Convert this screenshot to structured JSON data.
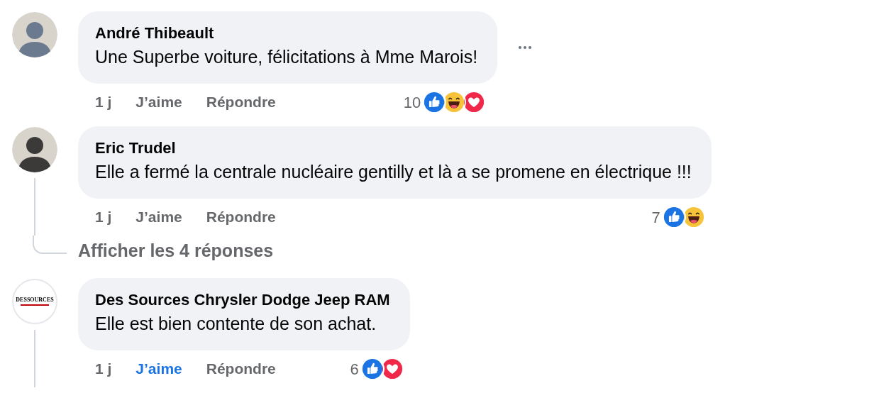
{
  "comments": [
    {
      "author": "André Thibeault",
      "text": "Une Superbe voiture, félicitations à Mme Marois!",
      "avatar": {
        "kind": "photo",
        "color": "#6b7a8f"
      },
      "more_button": true,
      "time": "1 j",
      "like_label": "J’aime",
      "liked": false,
      "reply_label": "Répondre",
      "reaction_count": "10",
      "reactions": [
        {
          "kind": "like"
        },
        {
          "kind": "haha"
        },
        {
          "kind": "love"
        }
      ],
      "has_replies": false
    },
    {
      "author": "Eric Trudel",
      "text": "Elle a fermé la centrale nucléaire gentilly et là a se promene en électrique !!!",
      "avatar": {
        "kind": "photo",
        "color": "#3b3a38"
      },
      "more_button": false,
      "time": "1 j",
      "like_label": "J’aime",
      "liked": false,
      "reply_label": "Répondre",
      "reaction_count": "7",
      "reactions": [
        {
          "kind": "like"
        },
        {
          "kind": "haha"
        }
      ],
      "has_replies": true,
      "replies_link": "Afficher les 4 réponses"
    },
    {
      "author": "Des Sources Chrysler Dodge Jeep RAM",
      "text": "Elle est bien contente de son achat.",
      "avatar": {
        "kind": "logo",
        "logo_text": "DESSOURCES"
      },
      "more_button": false,
      "time": "1 j",
      "like_label": "J’aime",
      "liked": true,
      "reply_label": "Répondre",
      "reaction_count": "6",
      "reactions": [
        {
          "kind": "like"
        },
        {
          "kind": "love"
        }
      ],
      "has_replies": true
    }
  ]
}
